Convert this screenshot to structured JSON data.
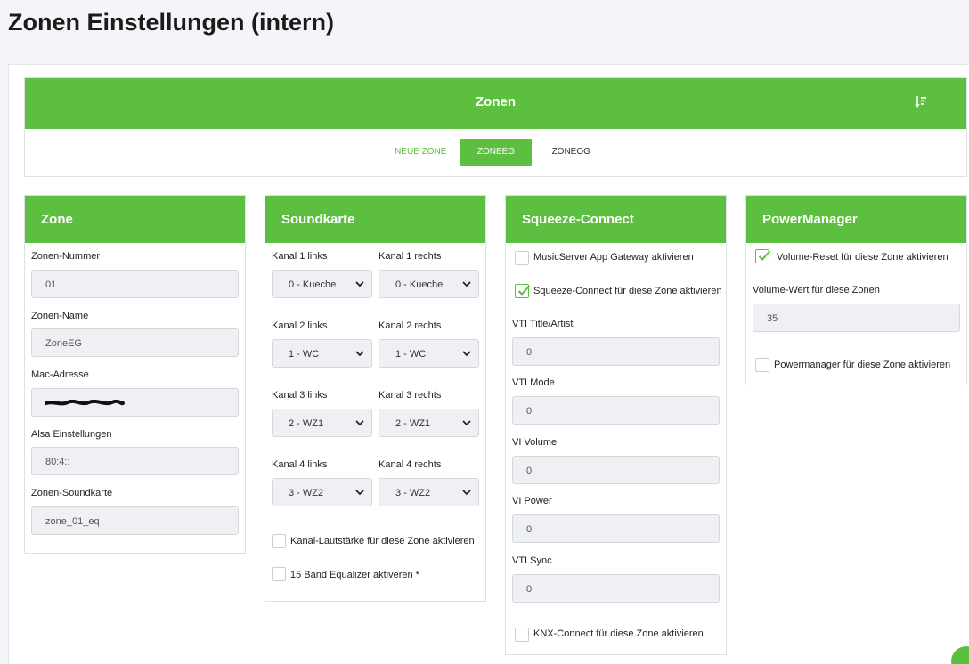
{
  "page": {
    "title": "Zonen Einstellungen (intern)"
  },
  "zonen": {
    "title": "Zonen",
    "tabs": [
      {
        "label": "NEUE ZONE"
      },
      {
        "label": "ZONEEG"
      },
      {
        "label": "ZONEOG"
      }
    ]
  },
  "zone": {
    "title": "Zone",
    "fields": [
      {
        "label": "Zonen-Nummer",
        "value": "01"
      },
      {
        "label": "Zonen-Name",
        "value": "ZoneEG"
      },
      {
        "label": "Mac-Adresse",
        "value": ""
      },
      {
        "label": "Alsa Einstellungen",
        "value": "80:4::"
      },
      {
        "label": "Zonen-Soundkarte",
        "value": "zone_01_eq"
      }
    ]
  },
  "soundkarte": {
    "title": "Soundkarte",
    "channels": [
      {
        "left_label": "Kanal 1 links",
        "left_value": "0 - Kueche",
        "right_label": "Kanal 1 rechts",
        "right_value": "0 - Kueche"
      },
      {
        "left_label": "Kanal 2 links",
        "left_value": "1 - WC",
        "right_label": "Kanal 2 rechts",
        "right_value": "1 - WC"
      },
      {
        "left_label": "Kanal 3 links",
        "left_value": "2 - WZ1",
        "right_label": "Kanal 3 rechts",
        "right_value": "2 - WZ1"
      },
      {
        "left_label": "Kanal 4 links",
        "left_value": "3 - WZ2",
        "right_label": "Kanal 4 rechts",
        "right_value": "3 - WZ2"
      }
    ],
    "checkboxes": [
      {
        "label": "Kanal-Lautstärke für diese Zone aktivieren",
        "checked": false
      },
      {
        "label": "15 Band Equalizer aktiveren *",
        "checked": false
      }
    ]
  },
  "squeeze": {
    "title": "Squeeze-Connect",
    "checkboxes": [
      {
        "label": "MusicServer App Gateway aktivieren",
        "checked": false
      },
      {
        "label": "Squeeze-Connect für diese Zone aktivieren",
        "checked": true
      },
      {
        "label": "KNX-Connect für diese Zone aktivieren",
        "checked": false
      }
    ],
    "fields": [
      {
        "label": "VTI Title/Artist",
        "value": "0"
      },
      {
        "label": "VTI Mode",
        "value": "0"
      },
      {
        "label": "VI Volume",
        "value": "0"
      },
      {
        "label": "VI Power",
        "value": "0"
      },
      {
        "label": "VTI Sync",
        "value": "0"
      }
    ]
  },
  "power": {
    "title": "PowerManager",
    "checkboxes": [
      {
        "label": "Volume-Reset für diese Zone aktivieren",
        "checked": true
      },
      {
        "label": "Powermanager für diese Zone aktivieren",
        "checked": false
      }
    ],
    "volume": {
      "label": "Volume-Wert für diese Zonen",
      "value": "35"
    }
  },
  "colors": {
    "accent": "#5cbf3f",
    "input_bg": "#eef0f3",
    "page_bg": "#f3f5f8"
  }
}
